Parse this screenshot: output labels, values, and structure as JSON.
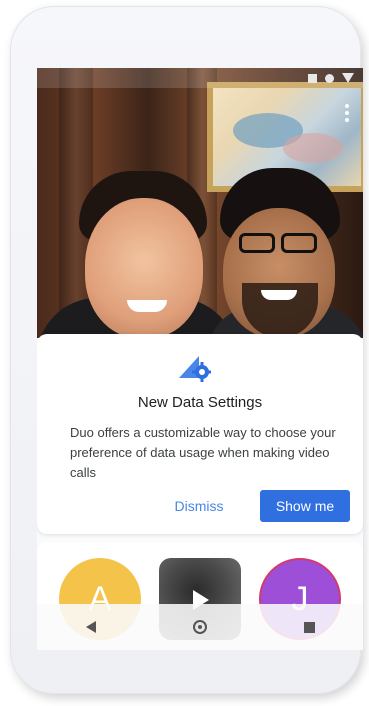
{
  "status_bar": {
    "icons": [
      "signal-square-icon",
      "dot-icon",
      "wifi-triangle-icon"
    ]
  },
  "photo": {
    "menu_icon": "more-vert-icon"
  },
  "dialog": {
    "icon": "data-settings-icon",
    "title": "New Data Settings",
    "body": "Duo offers a customizable way to choose your preference of data usage when making video calls",
    "dismiss_label": "Dismiss",
    "show_me_label": "Show me",
    "accent_color": "#2f6fe0"
  },
  "contacts": [
    {
      "initial": "A",
      "color": "#f4c34a"
    },
    {
      "type": "video",
      "icon": "play-icon"
    },
    {
      "initial": "J",
      "color": "#9d4fd8"
    }
  ],
  "nav_bar": {
    "icons": [
      "back-icon",
      "home-icon",
      "recents-icon"
    ]
  }
}
